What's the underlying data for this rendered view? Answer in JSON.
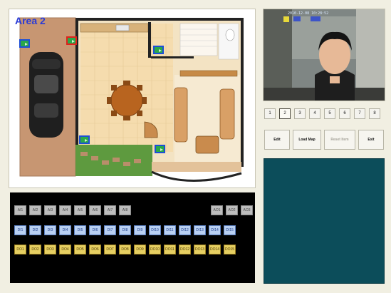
{
  "map": {
    "title": "Area 2",
    "cameras": [
      {
        "id": "cam-1",
        "selected": false
      },
      {
        "id": "cam-2",
        "selected": true
      },
      {
        "id": "cam-3",
        "selected": false
      },
      {
        "id": "cam-4",
        "selected": false
      },
      {
        "id": "cam-5",
        "selected": false
      }
    ]
  },
  "live_view": {
    "osd_text": "2010-12-08 10:28:52"
  },
  "channels": {
    "labels": [
      "1",
      "2",
      "3",
      "4",
      "5",
      "6",
      "7",
      "8"
    ],
    "active_index": 1
  },
  "controls": {
    "edit_label": "Edit",
    "load_map_label": "Load Map",
    "reset_label": "Reset Item",
    "exit_label": "Exit"
  },
  "device_panel": {
    "gray_row_left": [
      "AI1",
      "AI2",
      "AI3",
      "AI4",
      "AI5",
      "AI6",
      "AI7",
      "AI8"
    ],
    "gray_row_right": [
      "AO1",
      "AO2",
      "AO3"
    ],
    "blue_row": [
      "DI1",
      "DI2",
      "DI3",
      "DI4",
      "DI5",
      "DI6",
      "DI7",
      "DI8",
      "DI9",
      "DI10",
      "DI11",
      "DI12",
      "DI13",
      "DI14",
      "DI15"
    ],
    "gold_row": [
      "DO1",
      "DO2",
      "DO3",
      "DO4",
      "DO5",
      "DO6",
      "DO7",
      "DO8",
      "DO9",
      "DO10",
      "DO11",
      "DO12",
      "DO13",
      "DO14",
      "DO15"
    ]
  },
  "colors": {
    "app_background": "#f1efe2",
    "map_title": "#2a3bd6",
    "camera_icon": "#2aa84a",
    "camera_border": "#1d4fd6",
    "camera_selected_border": "#e0221c",
    "device_panel_bg": "#000000",
    "info_panel_bg": "#0c4d5a"
  }
}
